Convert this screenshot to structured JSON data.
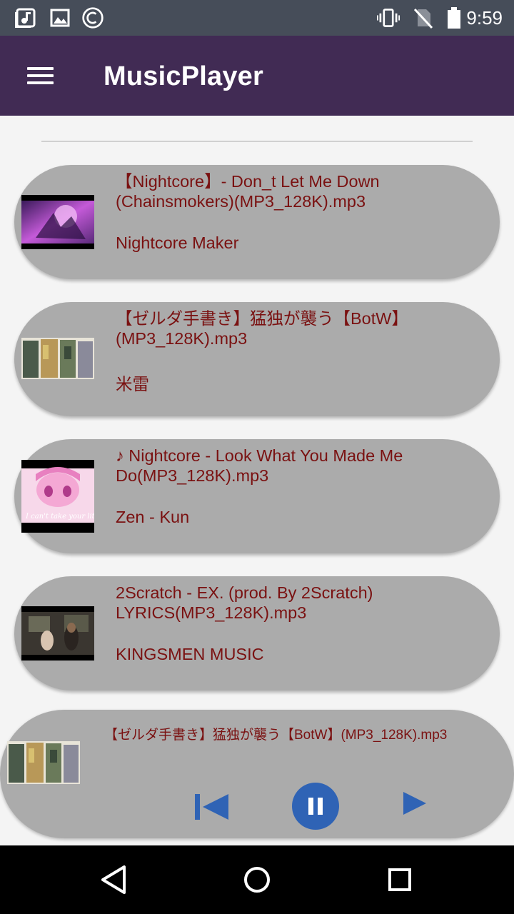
{
  "status_bar": {
    "time": "9:59",
    "left_icons": [
      "music-notification-icon",
      "image-notification-icon",
      "copyright-notification-icon"
    ],
    "right_icons": [
      "vibrate-icon",
      "no-sim-icon",
      "battery-icon"
    ]
  },
  "app_bar": {
    "title": "MusicPlayer",
    "color": "#412b54",
    "menu_icon": "hamburger-menu-icon"
  },
  "songs": [
    {
      "title": "【Nightcore】- Don_t Let Me Down (Chainsmokers)(MP3_128K).mp3",
      "artist": "Nightcore Maker"
    },
    {
      "title": "【ゼルダ手書き】猛独が襲う【BotW】(MP3_128K).mp3",
      "artist": "米雷"
    },
    {
      "title": "♪ Nightcore - Look What You Made Me Do(MP3_128K).mp3",
      "artist": "Zen - Kun"
    },
    {
      "title": "2Scratch - EX. (prod. By 2Scratch) LYRICS(MP3_128K).mp3",
      "artist": "KINGSMEN MUSIC"
    }
  ],
  "player": {
    "now_playing": "【ゼルダ手書き】猛独が襲う【BotW】(MP3_128K).mp3",
    "controls": [
      "previous-icon",
      "pause-icon",
      "next-icon"
    ],
    "accent": "#2f63b5"
  },
  "colors": {
    "card": "#ababab",
    "text": "#7a1111",
    "background": "#f4f4f4"
  },
  "nav_bar": {
    "buttons": [
      "back-icon",
      "home-icon",
      "recents-icon"
    ]
  }
}
